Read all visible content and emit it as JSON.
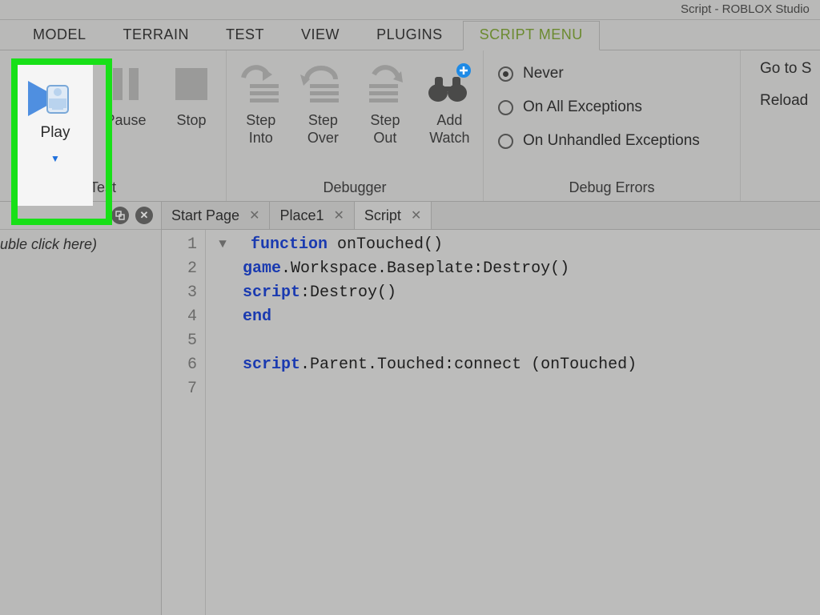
{
  "window": {
    "title": "Script - ROBLOX Studio"
  },
  "tabs": {
    "items": [
      {
        "label": "MODEL"
      },
      {
        "label": "TERRAIN"
      },
      {
        "label": "TEST"
      },
      {
        "label": "VIEW"
      },
      {
        "label": "PLUGINS"
      },
      {
        "label": "SCRIPT MENU"
      }
    ],
    "active": 5
  },
  "ribbon": {
    "test": {
      "label": "Test",
      "play": {
        "label": "Play"
      },
      "pause": {
        "label": "Pause"
      },
      "stop": {
        "label": "Stop"
      }
    },
    "debugger": {
      "label": "Debugger",
      "stepInto": {
        "label": "Step\nInto"
      },
      "stepOver": {
        "label": "Step\nOver"
      },
      "stepOut": {
        "label": "Step\nOut"
      },
      "addWatch": {
        "label": "Add\nWatch"
      }
    },
    "debugErrors": {
      "label": "Debug Errors",
      "options": [
        {
          "label": "Never",
          "selected": true
        },
        {
          "label": "On All Exceptions",
          "selected": false
        },
        {
          "label": "On Unhandled Exceptions",
          "selected": false
        }
      ]
    },
    "actions": {
      "goto": "Go to S",
      "reload": "Reload"
    }
  },
  "sidebar": {
    "placeholder": "uble click here)"
  },
  "editorTabs": [
    {
      "label": "Start Page"
    },
    {
      "label": "Place1"
    },
    {
      "label": "Script"
    }
  ],
  "code": {
    "lineNumbers": [
      "1",
      "2",
      "3",
      "4",
      "5",
      "6",
      "7"
    ],
    "lines": [
      {
        "indent": "",
        "tokens": []
      },
      {
        "fold": true,
        "tokens": [
          {
            "t": "kw",
            "v": "function"
          },
          {
            "t": "txt",
            "v": " onTouched()"
          }
        ]
      },
      {
        "tokens": [
          {
            "t": "nm",
            "v": "game"
          },
          {
            "t": "txt",
            "v": ".Workspace.Baseplate:Destroy()"
          }
        ]
      },
      {
        "tokens": [
          {
            "t": "nm",
            "v": "script"
          },
          {
            "t": "txt",
            "v": ":Destroy()"
          }
        ]
      },
      {
        "tokens": [
          {
            "t": "kw",
            "v": "end"
          }
        ]
      },
      {
        "tokens": []
      },
      {
        "tokens": [
          {
            "t": "nm",
            "v": "script"
          },
          {
            "t": "txt",
            "v": ".Parent.Touched:connect (onTouched)"
          }
        ]
      }
    ]
  }
}
